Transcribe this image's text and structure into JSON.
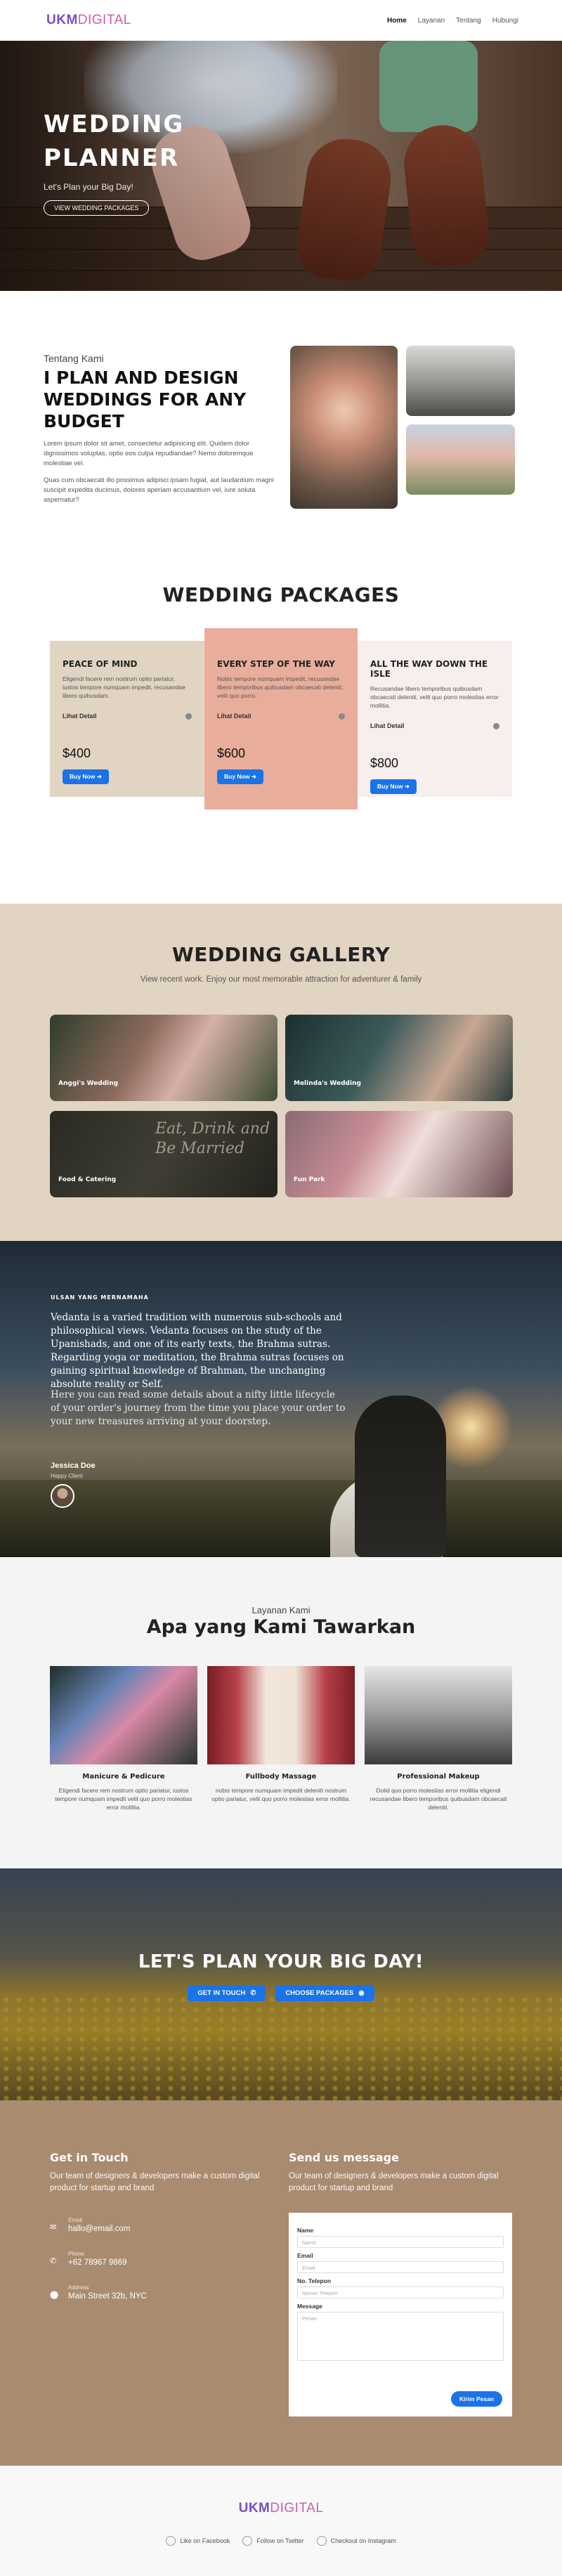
{
  "nav": {
    "logo_a": "UKM",
    "logo_b": "DIGITAL",
    "links": [
      "Home",
      "Layanan",
      "Tentang",
      "Hubungi"
    ]
  },
  "hero": {
    "title": "WEDDING PLANNER",
    "subtitle": "Let's Plan your Big Day!",
    "button": "VIEW WEDDING PACKAGES"
  },
  "about": {
    "eyebrow": "Tentang Kami",
    "title": "I PLAN AND DESIGN WEDDINGS FOR ANY BUDGET",
    "p1": "Lorem ipsum dolor sit amet, consectetur adipisicing elit. Quidem dolor dignissimos voluptas, optio eos culpa repudiandae? Nemo doloremque molestiae vel.",
    "p2": "Quas cum obcaecati illo possimus adipisci ipsam fugiat, aut laudantium magni suscipit expedita ducimus, dolores aperiam accusantium vel, iure soluta aspernatur?"
  },
  "packages": {
    "title": "WEDDING PACKAGES",
    "items": [
      {
        "name": "PEACE OF MIND",
        "desc": "Eligendi facere rem nostrum optio pariatur, iustos tempore numquam impedit, recusandae libero quibusdam.",
        "detail": "Lihat Detail",
        "price": "$400",
        "button": "Buy Now"
      },
      {
        "name": "EVERY STEP OF THE WAY",
        "desc": "Nobis tempore numquam impedit, recusandae libero temporibus quibusdam obcaecati deleniti, velit quo porro.",
        "detail": "Lihat Detail",
        "price": "$600",
        "button": "Buy Now"
      },
      {
        "name": "ALL THE WAY DOWN THE ISLE",
        "desc": "Recusandae libero temporibus quibusdam obcaecati deleniti, velit quo porro molestias error mollitia.",
        "detail": "Lihat Detail",
        "price": "$800",
        "button": "Buy Now"
      }
    ]
  },
  "gallery": {
    "title": "WEDDING GALLERY",
    "subtitle": "View recent work. Enjoy our most memorable attraction for adventurer & family",
    "items": [
      "Anggi's Wedding",
      "Melinda's Wedding",
      "Food & Catering",
      "Fun Park"
    ],
    "chalk_text": "Eat, Drink and Be Married"
  },
  "testimonial": {
    "kicker": "ULSAN YANG MERNAMAHA",
    "quote1": "Vedanta is a varied tradition with numerous sub-schools and philosophical views. Vedanta focuses on the study of the Upanishads, and one of its early texts, the Brahma sutras. Regarding yoga or meditation, the Brahma sutras focuses on gaining spiritual knowledge of Brahman, the unchanging absolute reality or Self.",
    "quote2": "Here you can read some details about a nifty little lifecycle of your order's journey from the time you place your order to your new treasures arriving at your doorstep.",
    "name": "Jessica Doe",
    "role": "Happy Client"
  },
  "services": {
    "eyebrow": "Layanan Kami",
    "title": "Apa yang Kami Tawarkan",
    "items": [
      {
        "name": "Manicure & Pedicure",
        "desc": "Eligendi facere rem nostrum optio pariatur, iustos tempore numquam impedit velit quo porro molestias error mollitia."
      },
      {
        "name": "Fullbody Massage",
        "desc": "nobis tempore numquam impedit deleniti nostrum optio pariatur, velit quo porro molestias error mollitia."
      },
      {
        "name": "Professional Makeup",
        "desc": "Dolid quo porro molestias error mollitia eligendi recusandae libero temporibus quibusdam obcaecati deleniti."
      }
    ]
  },
  "cta": {
    "title": "LET'S PLAN YOUR BIG DAY!",
    "btn1": "GET IN TOUCH",
    "btn2": "CHOOSE PACKAGES"
  },
  "contact": {
    "left_title": "Get in Touch",
    "left_text": "Our team of designers & developers make a custom digital product for startup and brand",
    "right_title": "Send us message",
    "right_text": "Our team of designers & developers make a custom digital product for startup and brand",
    "info": [
      {
        "label": "Email",
        "value": "hallo@email.com"
      },
      {
        "label": "Phone",
        "value": "+62 78967 9869"
      },
      {
        "label": "Address",
        "value": "Main Street 32b, NYC"
      }
    ],
    "form": {
      "name_label": "Name",
      "name_ph": "Name",
      "email_label": "Email",
      "email_ph": "Email",
      "phone_label": "No. Telepon",
      "phone_ph": "Nomor Telepon",
      "msg_label": "Message",
      "msg_ph": "Pesan",
      "submit": "Kirim Pesan"
    }
  },
  "footer": {
    "logo_a": "UKM",
    "logo_b": "DIGITAL",
    "socials": [
      "Like on Facebook",
      "Follow on Twitter",
      "Checkout on Instagram"
    ]
  }
}
